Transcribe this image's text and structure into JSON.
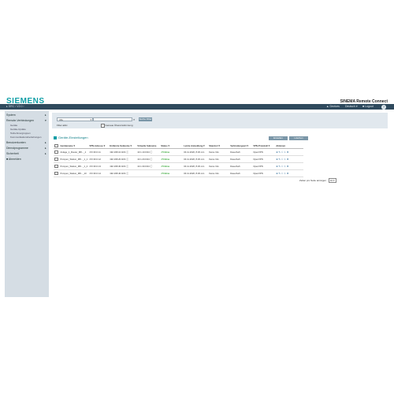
{
  "header": {
    "logo": "SIEMENS",
    "app_title": "SINEMA Remote Connect",
    "breadcrumb": "▸ SRC › V2.0 ›",
    "user": "Devices",
    "lang": "Deutsch",
    "logout": "Logout",
    "help": "?"
  },
  "sidebar": {
    "items": [
      {
        "label": "System",
        "arrow": "▸"
      },
      {
        "label": "Remote-Verbindungen",
        "arrow": "▾"
      },
      {
        "label": "Benutzerkonten",
        "arrow": "▸"
      },
      {
        "label": "Dienstprogramme",
        "arrow": "▸"
      },
      {
        "label": "Sicherheit",
        "arrow": "▸"
      },
      {
        "label": "Abmelden",
        "arrow": ""
      }
    ],
    "subitems": [
      "Geräte",
      "Geräte-Update",
      "Teilnehmergruppen",
      "Kommunikationsbeziehungen"
    ]
  },
  "filter": {
    "select_value": "Alle",
    "search_button": "Suche Filter",
    "label_filter": "Filter aktiv",
    "checkbox_label": "Genaue Übereinstimmung"
  },
  "section": {
    "title": "Geräte-Einstellungen",
    "btn_new": "Erstellen",
    "btn_delete": "Löschen"
  },
  "table": {
    "headers": [
      "Gerätename",
      "VPN-Adresse",
      "Entfernte Subnetze",
      "Virtuelle Subnetze",
      "Status",
      "Letzte Anmeldung",
      "Standort",
      "Verbindungsart",
      "VPN-Protokoll",
      "Aktionen"
    ],
    "rows": [
      {
        "name": "Anlage_1_Router_M8..._1",
        "vpn": "172.30.0.11",
        "remote": "192.168.10.0/24",
        "virtual": "10.1.10.0/24",
        "status": "Online",
        "login": "04.11.2020, 8:29 min",
        "location": "Keine Info",
        "conn": "Dauerhaft",
        "proto": "OpenVPN"
      },
      {
        "name": "Pumpen_Station_M8..._1_1",
        "vpn": "172.30.0.12",
        "remote": "192.168.20.0/24",
        "virtual": "10.1.20.0/24",
        "status": "Online",
        "login": "04.11.2020, 8:29 min",
        "location": "Keine Info",
        "conn": "Dauerhaft",
        "proto": "OpenVPN"
      },
      {
        "name": "Pumpen_Station_M8..._1_2",
        "vpn": "172.30.0.13",
        "remote": "192.168.30.0/24",
        "virtual": "10.1.30.0/24",
        "status": "Online",
        "login": "04.11.2020, 8:29 min",
        "location": "Keine Info",
        "conn": "Dauerhaft",
        "proto": "OpenVPN"
      },
      {
        "name": "Pumpen_Station_M8..._10",
        "vpn": "172.30.0.14",
        "remote": "192.168.40.0/24",
        "virtual": "",
        "status": "Online",
        "login": "04.11.2020, 8:29 min",
        "location": "Keine Info",
        "conn": "Dauerhaft",
        "proto": "OpenVPN"
      }
    ]
  },
  "pagination": {
    "label": "Zeilen pro Seite anzeigen",
    "value": "10"
  },
  "colors": {
    "brand": "#0f9ea6",
    "topbar": "#2f4a5d",
    "sidebar": "#d5dde4",
    "online": "#3aa83a"
  }
}
